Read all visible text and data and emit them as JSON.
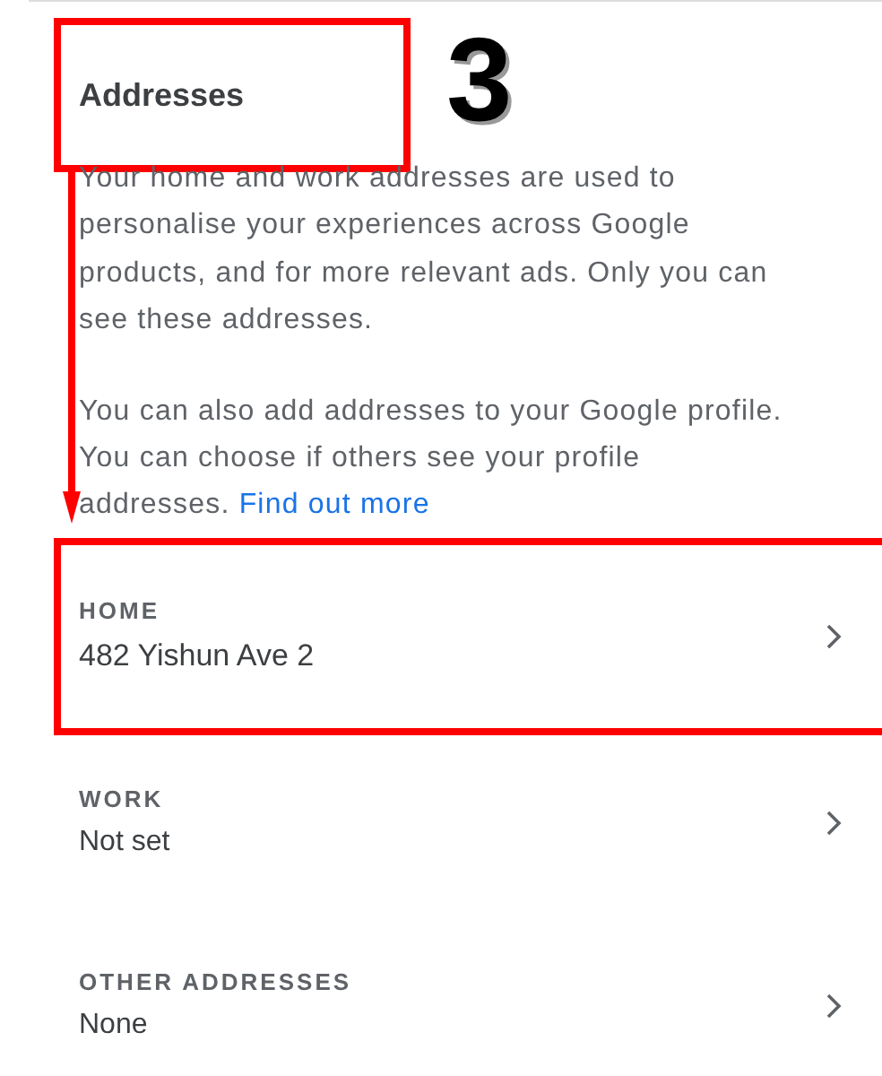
{
  "heading": {
    "title": "Addresses",
    "highlighted": true
  },
  "step_label": "3",
  "description": "Your home and work addresses are used to personalise your experiences across Google products, and for more relevant ads. Only you can see these addresses.",
  "profile_note": {
    "text": "You can also add addresses to your Google profile. You can choose if others see your profile addresses.",
    "link": "Find out more"
  },
  "addresses": [
    {
      "label": "HOME",
      "value": "482 Yishun Ave 2",
      "highlighted": true
    },
    {
      "label": "WORK",
      "value": "Not set",
      "highlighted": false
    },
    {
      "label": "OTHER ADDRESSES",
      "value": "None",
      "highlighted": false
    }
  ]
}
